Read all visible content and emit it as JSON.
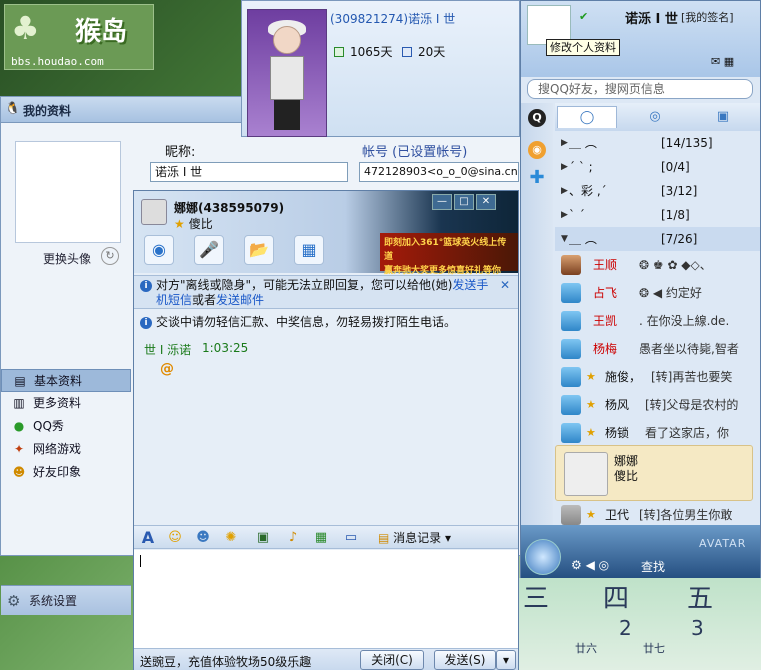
{
  "logo": {
    "mark": "猴岛",
    "url": "bbs.houdao.com"
  },
  "profile": {
    "title": "我的资料",
    "change_avatar": "更换头像",
    "nick_label": "昵称:",
    "account_label": "帐号 (已设置帐号)",
    "nickname": "诺泺 I 世",
    "email": "472128903<o_o_0@sina.cn>",
    "nav": [
      {
        "label": "基本资料",
        "icon": "id-card-icon"
      },
      {
        "label": "更多资料",
        "icon": "profile-icon"
      },
      {
        "label": "QQ秀",
        "icon": "qqshow-icon"
      },
      {
        "label": "网络游戏",
        "icon": "game-icon"
      },
      {
        "label": "好友印象",
        "icon": "impression-icon"
      }
    ],
    "settings": "系统设置"
  },
  "pet": {
    "name": "(309821274)诺泺 I 世",
    "days1": "1065天",
    "days2": "20天"
  },
  "chat": {
    "title": "娜娜(438595079)",
    "status": "傻比",
    "ad_line1": "即刻加入361°篮球英火线上传道",
    "ad_line2": "赢奔驰大奖更多惊喜好礼等你拿！",
    "note1_a": "对方\"离线或隐身\"，可能无法立即回复，您可以给他(她)",
    "note1_link1": "发送手机短信",
    "note1_b": "或者",
    "note1_link2": "发送邮件",
    "note2": "交谈中请勿轻信汇款、中奖信息，勿轻易拨打陌生电话。",
    "msg_sender": "世 I 泺诺",
    "msg_time": "1:03:25",
    "history_label": "消息记录",
    "promo": "送豌豆，充值体验牧场50级乐趣",
    "close_btn": "关闭(C)",
    "send_btn": "发送(S)"
  },
  "qq": {
    "online_mark": "✔",
    "nick": "诺泺 I 世",
    "signature": "[我的签名]",
    "tooltip": "修改个人资料",
    "search_placeholder": "搜QQ好友，搜网页信息",
    "groups": [
      {
        "name": "＿  ︵",
        "count": "[14/135]"
      },
      {
        "name": "ˊ  ˋ  ;",
        "count": "[0/4]"
      },
      {
        "name": "、彩 ,ˊ",
        "count": "[3/12]"
      },
      {
        "name": "ˋ  ˊ",
        "count": "[1/8]"
      },
      {
        "name": "＿  ︵",
        "count": "[7/26]"
      }
    ],
    "friends": [
      {
        "name": "王顺",
        "sig": "❂ ♚ ✿ ◆◇、"
      },
      {
        "name": "占飞",
        "sig": "❂ ◀ 约定好"
      },
      {
        "name": "王凯",
        "sig": ". 在你没上線.de."
      },
      {
        "name": "杨梅",
        "sig": "愚者坐以待毙,智者"
      },
      {
        "name": "施俊，",
        "sig": "[转]再苦也要笑"
      },
      {
        "name": "杨风",
        "sig": "[转]父母是农村的"
      },
      {
        "name": "杨锁",
        "sig": "看了这家店，你"
      }
    ],
    "selected": {
      "name": "娜娜",
      "sig": "傻比"
    },
    "last": {
      "name": "卫代",
      "sig": "[转]各位男生你敢"
    },
    "find": "查找",
    "brand": "AVATAR"
  },
  "calendar": {
    "days": [
      "三",
      "四",
      "五"
    ],
    "nums": [
      "2",
      "3"
    ],
    "subs": [
      "廿六",
      "廿七"
    ]
  }
}
